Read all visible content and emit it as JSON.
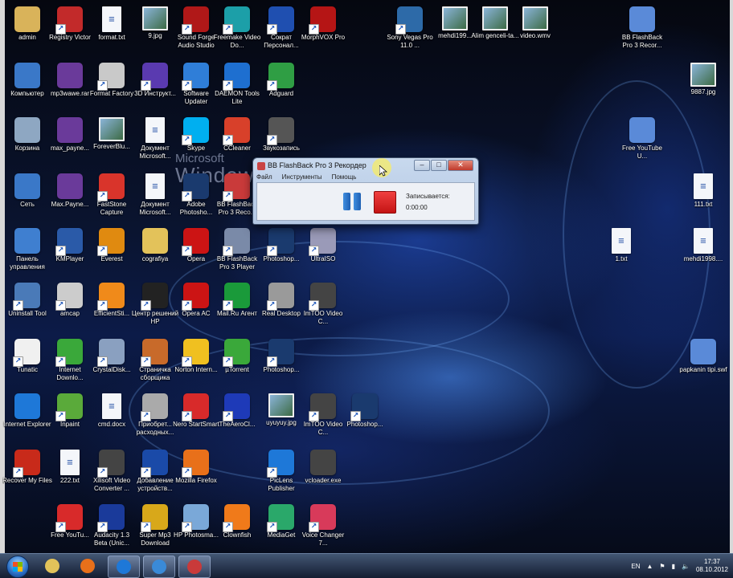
{
  "desktop": {
    "wallpaper_line1": "Microsoft",
    "wallpaper_line2": "Windows",
    "icons": [
      {
        "label": "admin",
        "icon": "user-folder-icon",
        "color": "#d9b35a",
        "kind": "glyph"
      },
      {
        "label": "Registry Victor",
        "icon": "registry-icon",
        "color": "#c22a2a",
        "kind": "shortcut"
      },
      {
        "label": "format.txt",
        "icon": "text-file-icon",
        "color": "#ffffff",
        "kind": "doc"
      },
      {
        "label": "9.jpg",
        "icon": "image-file-icon",
        "color": "#7aa",
        "kind": "img"
      },
      {
        "label": "Sound Forge Audio Studio",
        "icon": "sound-forge-icon",
        "color": "#b01818",
        "kind": "shortcut"
      },
      {
        "label": "Freemake Video Do...",
        "icon": "freemake-icon",
        "color": "#1c9fa8",
        "kind": "shortcut"
      },
      {
        "label": "Сократ Персонал...",
        "icon": "socrat-icon",
        "color": "#1f4fb0",
        "kind": "shortcut"
      },
      {
        "label": "MorphVOX Pro",
        "icon": "morphvox-icon",
        "color": "#b51515",
        "kind": "shortcut"
      },
      {
        "label": "Sony Vegas Pro 11.0 ...",
        "icon": "sony-vegas-icon",
        "color": "#2d6aa8",
        "kind": "shortcut"
      },
      {
        "label": "mehdi199...",
        "icon": "video-file-icon",
        "color": "#222",
        "kind": "img"
      },
      {
        "label": "Alim genceli-ta...",
        "icon": "video-thumbnail-icon",
        "color": "#445",
        "kind": "img"
      },
      {
        "label": "video.wmv",
        "icon": "wmv-file-icon",
        "color": "#345",
        "kind": "img"
      },
      {
        "label": "BB FlashBack Pro 3 Recor...",
        "icon": "swf-file-icon",
        "color": "#5a8ad8",
        "kind": "glyph"
      },
      {
        "label": "Компьютер",
        "icon": "computer-icon",
        "color": "#3a78c8",
        "kind": "glyph"
      },
      {
        "label": "mp3wawe.rar",
        "icon": "winrar-icon",
        "color": "#6a3a9a",
        "kind": "glyph"
      },
      {
        "label": "Format Factory",
        "icon": "format-factory-icon",
        "color": "#c9c9c9",
        "kind": "shortcut"
      },
      {
        "label": "3D Инструкт...",
        "icon": "3d-instructor-icon",
        "color": "#5a3ab0",
        "kind": "shortcut"
      },
      {
        "label": "Software Updater",
        "icon": "software-updater-icon",
        "color": "#2f7ed8",
        "kind": "shortcut"
      },
      {
        "label": "DAEMON Tools Lite",
        "icon": "daemon-tools-icon",
        "color": "#1e6fd0",
        "kind": "shortcut"
      },
      {
        "label": "Adguard",
        "icon": "adguard-icon",
        "color": "#2f9e44",
        "kind": "shortcut"
      },
      {
        "label": "9887.jpg",
        "icon": "image-file-icon",
        "color": "#7a6",
        "kind": "img"
      },
      {
        "label": "Корзина",
        "icon": "recycle-bin-icon",
        "color": "#8ea7c2",
        "kind": "glyph"
      },
      {
        "label": "max_payne...",
        "icon": "winrar-icon",
        "color": "#6a3a9a",
        "kind": "glyph"
      },
      {
        "label": "ForeverBlu...",
        "icon": "theme-file-icon",
        "color": "#1a2a5a",
        "kind": "img"
      },
      {
        "label": "Документ Microsoft...",
        "icon": "word-doc-icon",
        "color": "#2b579a",
        "kind": "doc"
      },
      {
        "label": "Skype",
        "icon": "skype-icon",
        "color": "#00aff0",
        "kind": "shortcut"
      },
      {
        "label": "CCleaner",
        "icon": "ccleaner-icon",
        "color": "#d8402a",
        "kind": "shortcut"
      },
      {
        "label": "Звукозапись",
        "icon": "microphone-icon",
        "color": "#555",
        "kind": "shortcut"
      },
      {
        "label": "Free YouTube U...",
        "icon": "swf-file-icon",
        "color": "#5a8ad8",
        "kind": "glyph"
      },
      {
        "label": "Сеть",
        "icon": "network-icon",
        "color": "#3a78c8",
        "kind": "glyph"
      },
      {
        "label": "Max.Payne...",
        "icon": "winrar-icon",
        "color": "#6a3a9a",
        "kind": "glyph"
      },
      {
        "label": "FastStone Capture",
        "icon": "faststone-icon",
        "color": "#d9342b",
        "kind": "shortcut"
      },
      {
        "label": "Документ Microsoft...",
        "icon": "text-file-icon",
        "color": "#ffffff",
        "kind": "doc"
      },
      {
        "label": "Adobe Photosho...",
        "icon": "photoshop-icon",
        "color": "#1a3a6e",
        "kind": "shortcut"
      },
      {
        "label": "BB FlashBack Pro 3 Reco...",
        "icon": "flashback-recorder-icon",
        "color": "#c93a3a",
        "kind": "shortcut"
      },
      {
        "label": "111.txt",
        "icon": "text-file-icon",
        "color": "#ffffff",
        "kind": "doc"
      },
      {
        "label": "Панель управления",
        "icon": "control-panel-icon",
        "color": "#3f7fd0",
        "kind": "glyph"
      },
      {
        "label": "KMPlayer",
        "icon": "kmplayer-icon",
        "color": "#2a5aa8",
        "kind": "shortcut"
      },
      {
        "label": "Everest",
        "icon": "everest-icon",
        "color": "#e08a10",
        "kind": "shortcut"
      },
      {
        "label": "cografiya",
        "icon": "folder-icon",
        "color": "#e3c25a",
        "kind": "glyph"
      },
      {
        "label": "Opera",
        "icon": "opera-icon",
        "color": "#cc1414",
        "kind": "shortcut"
      },
      {
        "label": "BB FlashBack Pro 3 Player",
        "icon": "flashback-player-icon",
        "color": "#7a8aa8",
        "kind": "shortcut"
      },
      {
        "label": "Photoshop...",
        "icon": "photoshop-icon",
        "color": "#1a3a6e",
        "kind": "shortcut"
      },
      {
        "label": "UltraISO",
        "icon": "ultraiso-icon",
        "color": "#9a9ab8",
        "kind": "shortcut"
      },
      {
        "label": "1.txt",
        "icon": "text-file-icon",
        "color": "#ffffff",
        "kind": "doc"
      },
      {
        "label": "mehdi1998....",
        "icon": "text-file-icon",
        "color": "#ffffff",
        "kind": "doc"
      },
      {
        "label": "Uninstall Tool",
        "icon": "uninstall-tool-icon",
        "color": "#4a7ab8",
        "kind": "shortcut"
      },
      {
        "label": "amcap",
        "icon": "amcap-icon",
        "color": "#ccc",
        "kind": "shortcut"
      },
      {
        "label": "EfficientSti...",
        "icon": "efficient-icon",
        "color": "#f08a1a",
        "kind": "shortcut"
      },
      {
        "label": "Центр решений HP",
        "icon": "hp-icon",
        "color": "#222",
        "kind": "shortcut"
      },
      {
        "label": "Opera AC",
        "icon": "opera-icon",
        "color": "#cc1414",
        "kind": "shortcut"
      },
      {
        "label": "Mail.Ru Агент",
        "icon": "mailru-agent-icon",
        "color": "#1a9a3a",
        "kind": "shortcut"
      },
      {
        "label": "Real Desktop",
        "icon": "real-desktop-icon",
        "color": "#9a9a9a",
        "kind": "shortcut"
      },
      {
        "label": "ImTOO Video C...",
        "icon": "film-reel-icon",
        "color": "#444",
        "kind": "shortcut"
      },
      {
        "label": "Tunatic",
        "icon": "tunatic-icon",
        "color": "#f0f0f0",
        "kind": "shortcut"
      },
      {
        "label": "Internet Downlo...",
        "icon": "idm-icon",
        "color": "#3aa83a",
        "kind": "shortcut"
      },
      {
        "label": "CrystalDisk...",
        "icon": "crystaldisk-icon",
        "color": "#8aa0c0",
        "kind": "shortcut"
      },
      {
        "label": "Страничка сборщика",
        "icon": "globe-page-icon",
        "color": "#c86a2a",
        "kind": "shortcut"
      },
      {
        "label": "Norton Intern...",
        "icon": "norton-icon",
        "color": "#f0c020",
        "kind": "shortcut"
      },
      {
        "label": "µTorrent",
        "icon": "utorrent-icon",
        "color": "#3aa83a",
        "kind": "shortcut"
      },
      {
        "label": "Photoshop...",
        "icon": "photoshop-icon",
        "color": "#1a3a6e",
        "kind": "shortcut"
      },
      {
        "label": "papkanin tipi.swf",
        "icon": "swf-file-icon",
        "color": "#5a8ad8",
        "kind": "glyph"
      },
      {
        "label": "Internet Explorer",
        "icon": "internet-explorer-icon",
        "color": "#1e78d8",
        "kind": "glyph"
      },
      {
        "label": "Inpaint",
        "icon": "inpaint-icon",
        "color": "#5aaa3a",
        "kind": "shortcut"
      },
      {
        "label": "cmd.docx",
        "icon": "word-doc-icon",
        "color": "#2b579a",
        "kind": "doc"
      },
      {
        "label": "Приобрет... расходных...",
        "icon": "printer-icon",
        "color": "#aaa",
        "kind": "shortcut"
      },
      {
        "label": "Nero StartSmart",
        "icon": "nero-icon",
        "color": "#d82a2a",
        "kind": "shortcut"
      },
      {
        "label": "TheAeroCl...",
        "icon": "aero-clock-icon",
        "color": "#1e3ab8",
        "kind": "shortcut"
      },
      {
        "label": "uyuyuy.jpg",
        "icon": "image-file-icon",
        "color": "#aaa",
        "kind": "img"
      },
      {
        "label": "ImTOO Video C...",
        "icon": "film-reel-icon",
        "color": "#444",
        "kind": "shortcut"
      },
      {
        "label": "Photoshop...",
        "icon": "photoshop-icon",
        "color": "#1a3a6e",
        "kind": "shortcut"
      },
      {
        "label": "Recover My Files",
        "icon": "recover-files-icon",
        "color": "#c82a1a",
        "kind": "shortcut"
      },
      {
        "label": "222.txt",
        "icon": "text-file-icon",
        "color": "#ffffff",
        "kind": "doc"
      },
      {
        "label": "Xilisoft Video Converter ...",
        "icon": "film-reel-icon",
        "color": "#444",
        "kind": "shortcut"
      },
      {
        "label": "Добавление устройств...",
        "icon": "hp-icon",
        "color": "#1a4aa8",
        "kind": "shortcut"
      },
      {
        "label": "Mozilla Firefox",
        "icon": "firefox-icon",
        "color": "#e8701a",
        "kind": "shortcut"
      },
      {
        "label": "PicLens Publisher",
        "icon": "piclens-icon",
        "color": "#1e78d8",
        "kind": "shortcut"
      },
      {
        "label": "vcloader.exe",
        "icon": "film-reel-icon",
        "color": "#444",
        "kind": "glyph"
      },
      {
        "label": "Free YouTu...",
        "icon": "youtube-download-icon",
        "color": "#d82a2a",
        "kind": "shortcut"
      },
      {
        "label": "Audacity 1.3 Beta (Unic...",
        "icon": "audacity-icon",
        "color": "#1a3a9a",
        "kind": "shortcut"
      },
      {
        "label": "Super Mp3 Download",
        "icon": "super-mp3-icon",
        "color": "#d8a81a",
        "kind": "shortcut"
      },
      {
        "label": "HP Photosma...",
        "icon": "hp-photosmart-icon",
        "color": "#7aa8d8",
        "kind": "shortcut"
      },
      {
        "label": "Clownfish",
        "icon": "clownfish-icon",
        "color": "#f07a1a",
        "kind": "shortcut"
      },
      {
        "label": "MediaGet",
        "icon": "mediaget-icon",
        "color": "#2aa86a",
        "kind": "shortcut"
      },
      {
        "label": "Voice Changer 7...",
        "icon": "voice-changer-icon",
        "color": "#d83a5a",
        "kind": "shortcut"
      }
    ]
  },
  "recorder": {
    "title": "BB FlashBack Pro 3 Рекордер",
    "menu": [
      "Файл",
      "Инструменты",
      "Помощь"
    ],
    "status": "Записывается:",
    "time": "0:00:00",
    "pause_label": "Пауза",
    "stop_label": "Стоп"
  },
  "taskbar": {
    "lang": "EN",
    "time": "17:37",
    "date": "08.10.2012",
    "buttons": [
      "windows-explorer-icon",
      "firefox-icon",
      "internet-explorer-icon",
      "skype-like-icon",
      "flashback-recorder-icon"
    ]
  }
}
